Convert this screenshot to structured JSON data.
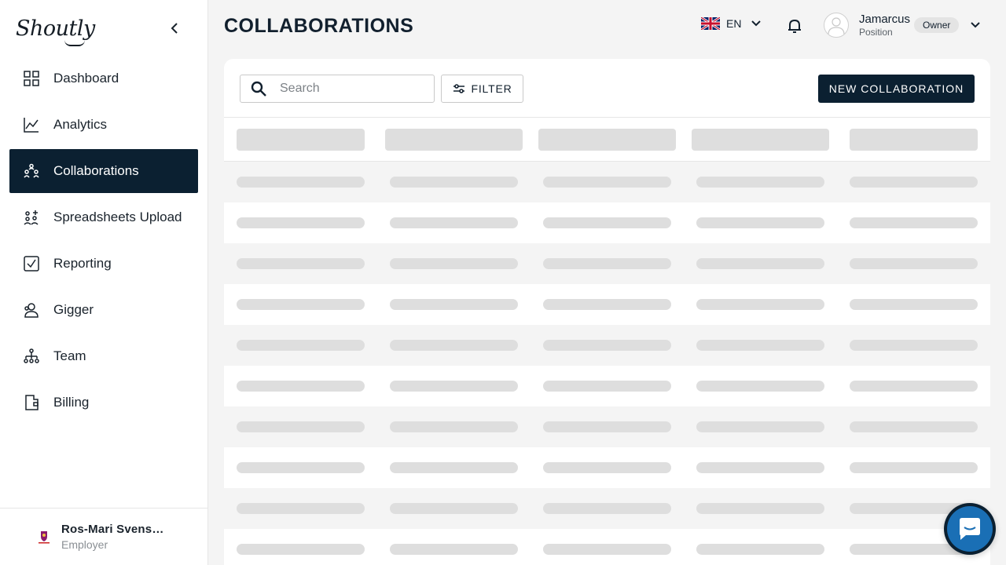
{
  "app": {
    "logo_text": "Shoutly"
  },
  "sidebar": {
    "items": [
      {
        "label": "Dashboard",
        "icon": "dashboard-icon",
        "active": false
      },
      {
        "label": "Analytics",
        "icon": "analytics-icon",
        "active": false
      },
      {
        "label": "Collaborations",
        "icon": "collaborations-icon",
        "active": true
      },
      {
        "label": "Spreadsheets Upload",
        "icon": "spreadsheet-upload-icon",
        "active": false
      },
      {
        "label": "Reporting",
        "icon": "reporting-icon",
        "active": false
      },
      {
        "label": "Gigger",
        "icon": "gigger-icon",
        "active": false
      },
      {
        "label": "Team",
        "icon": "team-icon",
        "active": false
      },
      {
        "label": "Billing",
        "icon": "billing-icon",
        "active": false
      }
    ],
    "footer": {
      "company_name": "Ros-Mari Svensso...",
      "role": "Employer"
    }
  },
  "header": {
    "title": "COLLABORATIONS",
    "language": "EN",
    "user": {
      "name": "Jamarcus",
      "position": "Position",
      "badge": "Owner"
    }
  },
  "toolbar": {
    "search_placeholder": "Search",
    "filter_label": "FILTER",
    "new_button_label": "NEW COLLABORATION"
  },
  "table": {
    "state": "loading",
    "skeleton_rows": 10,
    "columns": 5
  },
  "colors": {
    "primary_dark": "#0b2031",
    "skeleton": "#dedede",
    "background": "#f4f4f4",
    "chat_blue": "#1a6fb5"
  }
}
